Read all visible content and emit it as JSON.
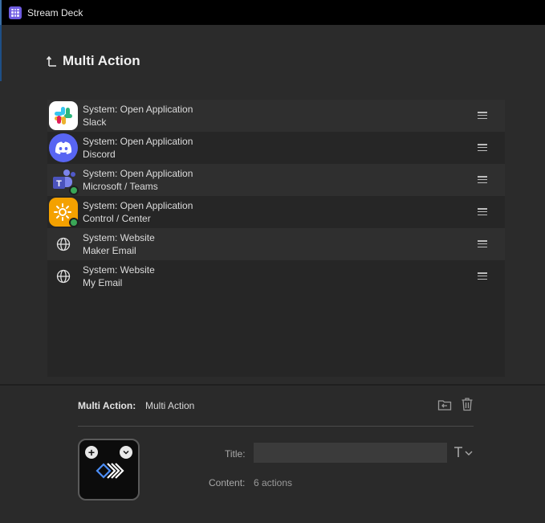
{
  "window": {
    "title": "Stream Deck"
  },
  "header": {
    "title": "Multi Action",
    "back_icon": "arrow-up-left-icon"
  },
  "actions": [
    {
      "type": "System: Open Application",
      "target": "Slack",
      "icon": "slack-icon"
    },
    {
      "type": "System: Open Application",
      "target": "Discord",
      "icon": "discord-icon"
    },
    {
      "type": "System: Open Application",
      "target": "Microsoft / Teams",
      "icon": "teams-icon"
    },
    {
      "type": "System: Open Application",
      "target": "Control / Center",
      "icon": "control-center-icon"
    },
    {
      "type": "System: Website",
      "target": "Maker Email",
      "icon": "globe-icon"
    },
    {
      "type": "System: Website",
      "target": "My Email",
      "icon": "globe-icon"
    }
  ],
  "inspector": {
    "name_label": "Multi Action:",
    "name_value": "Multi Action",
    "title_label": "Title:",
    "title_value": "",
    "content_label": "Content:",
    "content_value": "6 actions"
  },
  "colors": {
    "discord": "#5865f2",
    "teams": "#4b53bc",
    "control_center": "#f4a100",
    "status_green": "#3aa757",
    "accent": "#6f5ce0"
  }
}
